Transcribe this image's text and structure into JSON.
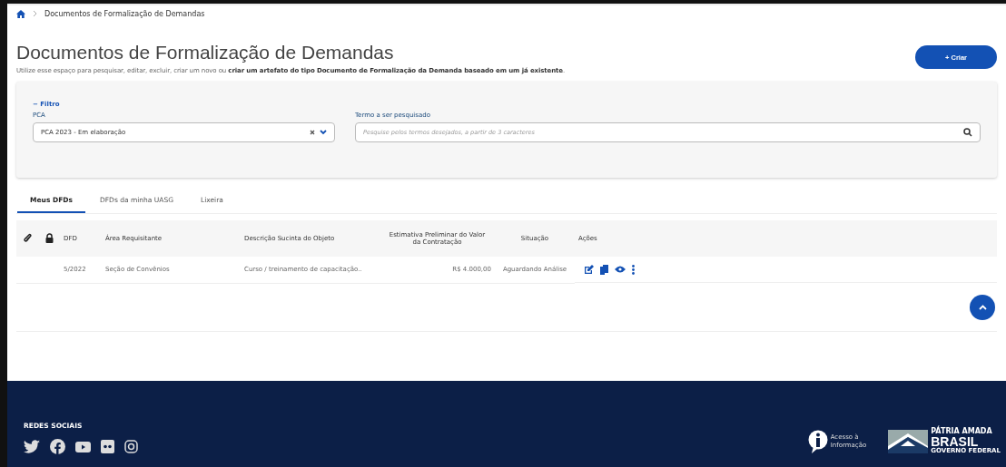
{
  "breadcrumb": {
    "current": "Documentos de Formalização de Demandas"
  },
  "header": {
    "title": "Documentos de Formalização de Demandas",
    "subtitle": "Utilize esse espaço para pesquisar, editar, excluir, criar um novo ou **criar um artefato do tipo Documento de Formalização da Demanda baseado em um já existente**.",
    "create_button": "+ Criar"
  },
  "filter": {
    "toggle": "−",
    "label": "Filtro",
    "expanded": true,
    "pca": {
      "label": "PCA",
      "value": "PCA 2023 - Em elaboração"
    },
    "search": {
      "label": "Termo a ser pesquisado",
      "placeholder": "Pesquise pelos termos desejados, a partir de 3 caracteres"
    }
  },
  "tabs": [
    {
      "label": "Meus DFDs",
      "selected": true
    },
    {
      "label": "DFDs da minha UASG",
      "selected": false
    },
    {
      "label": "Lixeira",
      "selected": false
    }
  ],
  "table": {
    "columns": [
      "DFD",
      "Área Requisitante",
      "Descrição Sucinta do Objeto",
      "Estimativa Preliminar do Valor da Contratação",
      "Situação",
      "Ações"
    ],
    "rows": [
      {
        "dfd": "5/2022",
        "area": "Seção de Convênios",
        "descricao": "Curso / treinamento de capacitação..",
        "valor": "R$ 4.000,00",
        "situacao": "Aguardando Análise"
      }
    ]
  },
  "footer": {
    "social_title": "REDES SOCIAIS",
    "access": [
      "Acesso à",
      "Informação"
    ],
    "brand": [
      "PÁTRIA AMADA",
      "BRASIL",
      "GOVERNO FEDERAL"
    ]
  }
}
